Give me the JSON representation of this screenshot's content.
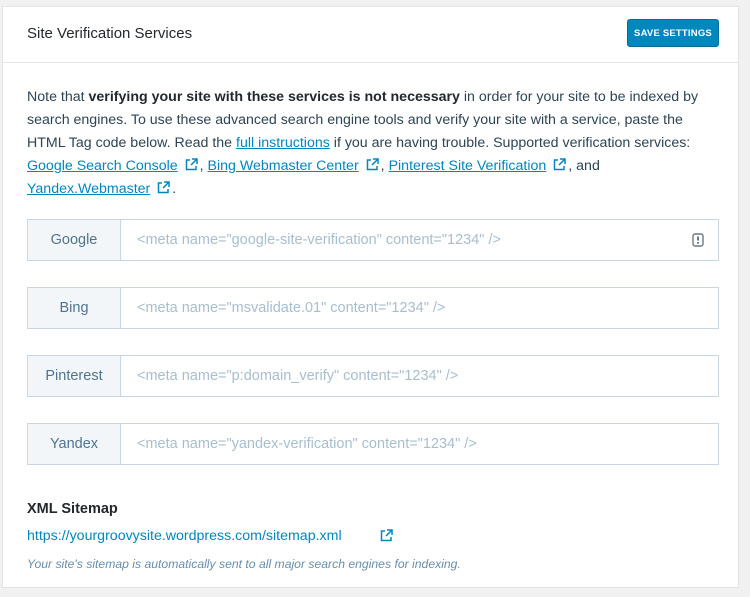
{
  "header": {
    "title": "Site Verification Services",
    "save_label": "SAVE SETTINGS"
  },
  "intro": {
    "text_1": "Note that ",
    "bold": "verifying your site with these services is not necessary",
    "text_2": " in order for your site to be indexed by search engines. To use these advanced search engine tools and verify your site with a service, paste the HTML Tag code below. Read the ",
    "full_instructions_link": "full instructions",
    "text_3": " if you are having trouble. Supported verification services: ",
    "google_link": "Google Search Console",
    "sep_1": ", ",
    "bing_link": "Bing Webmaster Center",
    "sep_2": ", ",
    "pinterest_link": "Pinterest Site Verification",
    "sep_3": ", and",
    "yandex_link": "Yandex.Webmaster",
    "text_end": "."
  },
  "services": [
    {
      "label": "Google",
      "placeholder": "<meta name=\"google-site-verification\" content=\"1234\" />",
      "value": ""
    },
    {
      "label": "Bing",
      "placeholder": "<meta name=\"msvalidate.01\" content=\"1234\" />",
      "value": ""
    },
    {
      "label": "Pinterest",
      "placeholder": "<meta name=\"p:domain_verify\" content=\"1234\" />",
      "value": ""
    },
    {
      "label": "Yandex",
      "placeholder": "<meta name=\"yandex-verification\" content=\"1234\" />",
      "value": ""
    }
  ],
  "sitemap": {
    "title": "XML Sitemap",
    "url": "https://yourgroovysite.wordpress.com/sitemap.xml",
    "note": "Your site's sitemap is automatically sent to all major search engines for indexing."
  },
  "colors": {
    "accent": "#0087be",
    "background": "#f1f1f1",
    "label_bg": "#f3f6f8",
    "border": "#c8d7e1"
  },
  "icons": {
    "external": "external-link-icon",
    "autofill": "autofill-icon"
  }
}
